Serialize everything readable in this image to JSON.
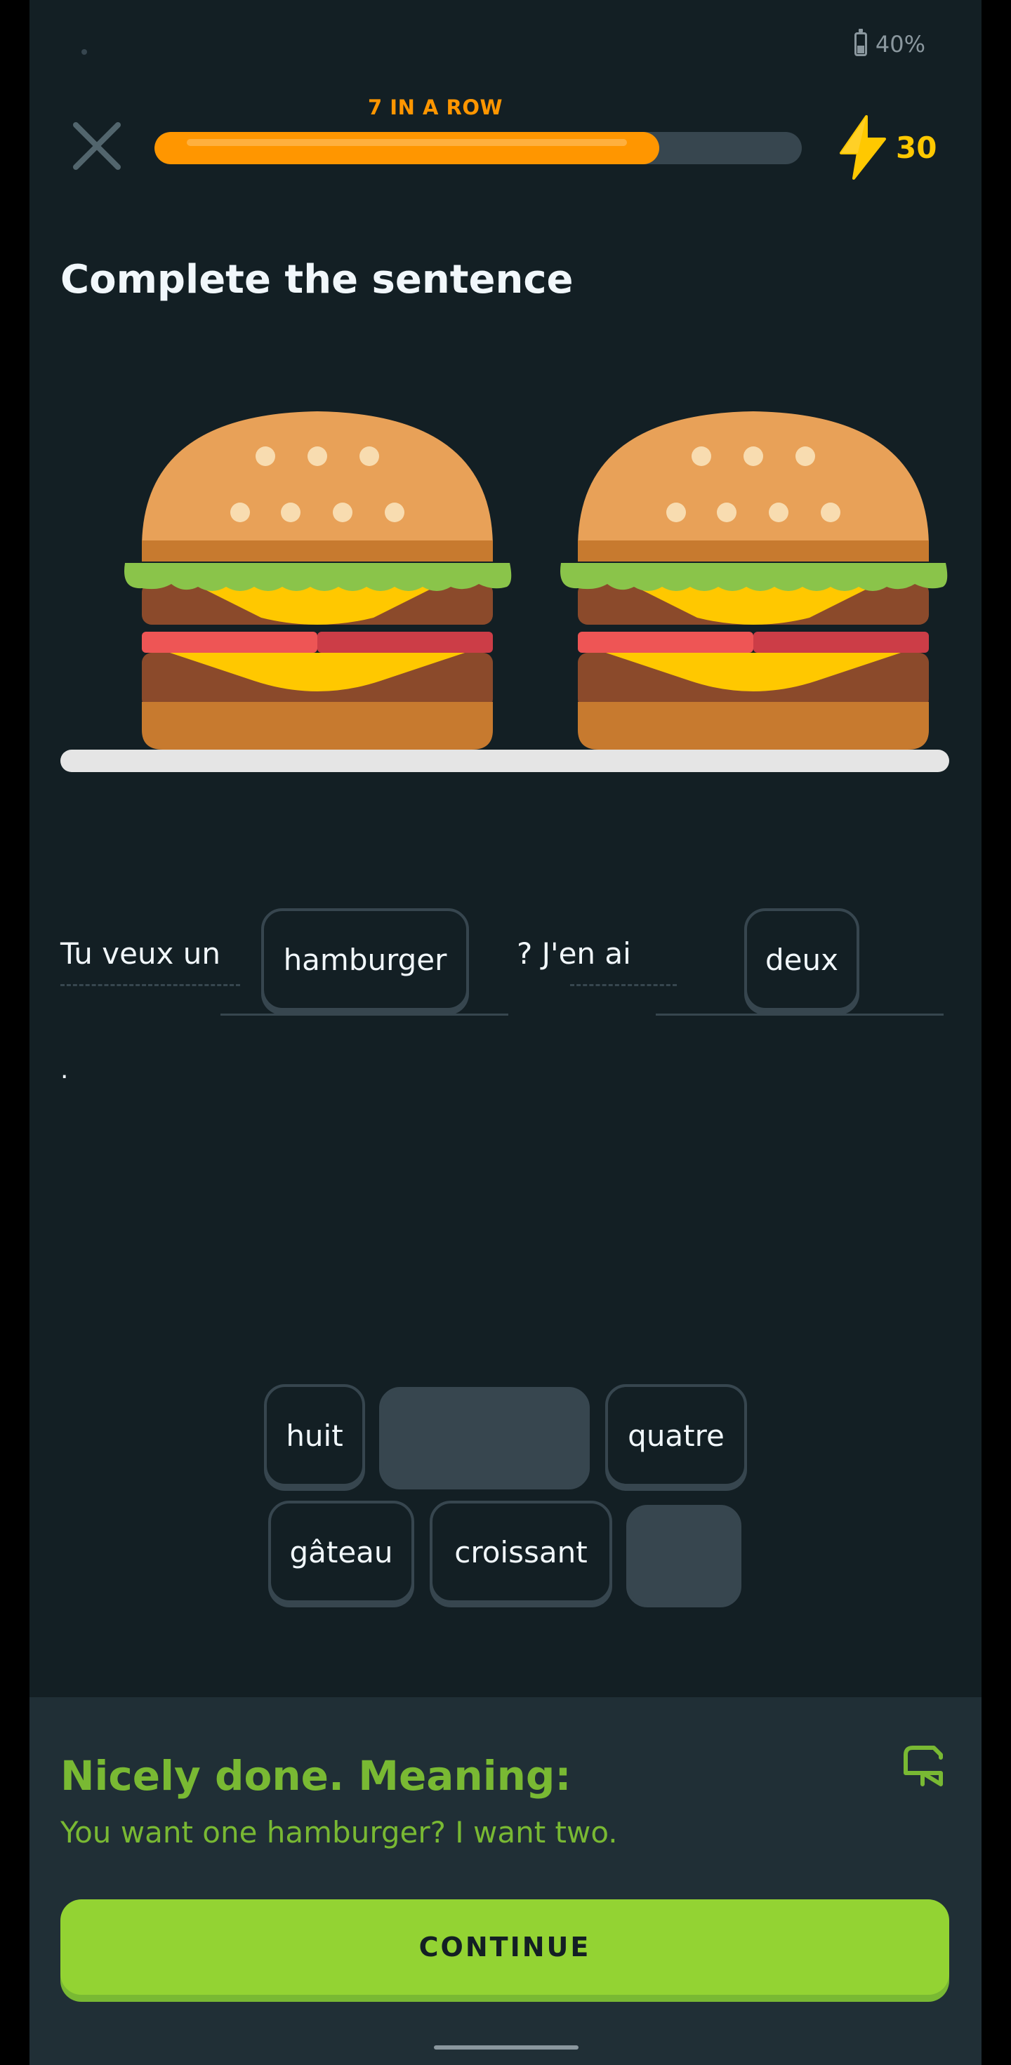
{
  "status_bar": {
    "battery": "40%",
    "battery_icon": "battery-icon"
  },
  "header": {
    "close_icon": "close-icon",
    "streak_label": "7 IN A ROW",
    "progress_fraction": 0.78,
    "gem_icon": "lightning-icon",
    "gem_count": "30",
    "accent_color": "#ff9600",
    "gem_color": "#ffc800"
  },
  "prompt": {
    "title": "Complete the sentence",
    "illustration": "two-hamburgers-illustration"
  },
  "sentence": {
    "part1": "Tu veux un",
    "blank1": "hamburger",
    "part2": "? J'en ai",
    "blank2": "deux",
    "end": "."
  },
  "word_bank": {
    "row1": [
      "huit",
      "",
      "quatre"
    ],
    "row2": [
      "gâteau",
      "croissant",
      ""
    ]
  },
  "feedback": {
    "title": "Nicely done. Meaning:",
    "meaning": "You want one hamburger? I want two.",
    "flag_icon": "flag-icon",
    "button": "CONTINUE",
    "color": "#79b933",
    "button_color": "#93d333"
  }
}
